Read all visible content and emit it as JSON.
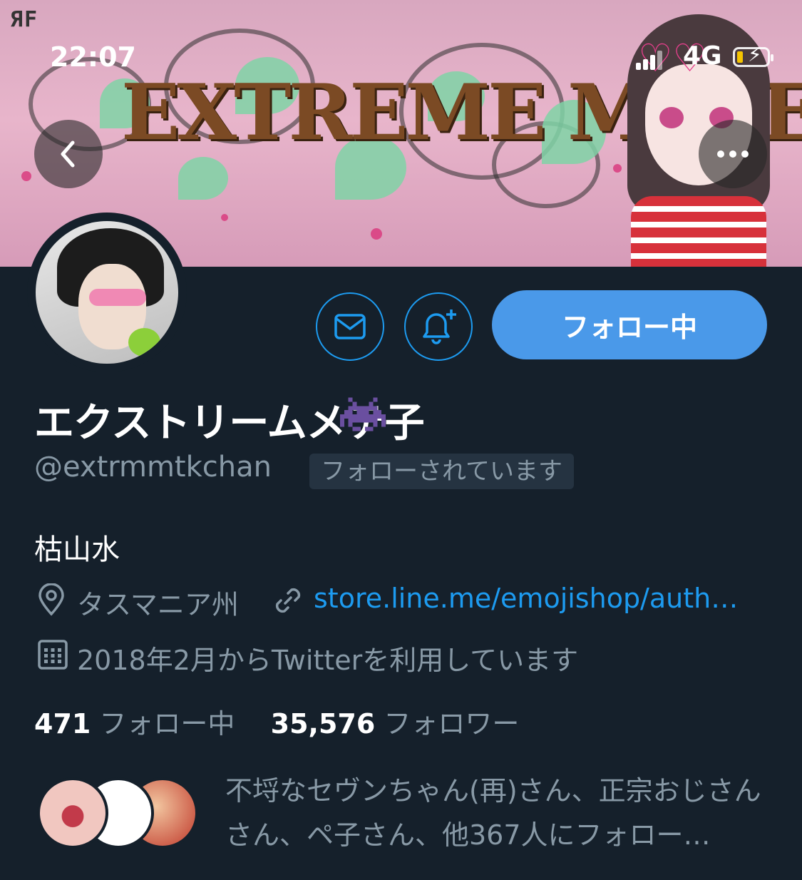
{
  "status_bar": {
    "time": "22:07",
    "network": "4G"
  },
  "banner": {
    "title_art": "EXTREME METEKO",
    "logo_text": "ЯF"
  },
  "profile": {
    "name": "エクストリームメテ子",
    "handle": "@extrmmtkchan",
    "follows_you_badge": "フォローされています",
    "bio": "枯山水",
    "location": "タスマニア州",
    "website": "store.line.me/emojishop/auth…",
    "joined": "2018年2月からTwitterを利用しています"
  },
  "actions": {
    "follow_button": "フォロー中"
  },
  "stats": {
    "following_count": "471",
    "following_label": "フォロー中",
    "followers_count": "35,576",
    "followers_label": "フォロワー"
  },
  "followed_by": {
    "text": "不埒なセヴンちゃん(再)さん、正宗おじさんさん、ペ子さん、他367人にフォロー…"
  },
  "icons": [
    "back-icon",
    "more-icon",
    "mail-icon",
    "bell-plus-icon",
    "location-icon",
    "link-icon",
    "calendar-icon",
    "alien-monster-icon"
  ],
  "colors": {
    "background": "#15202b",
    "accent": "#1d9bf0",
    "follow_button": "#4a99e9",
    "muted": "#8899a6"
  }
}
